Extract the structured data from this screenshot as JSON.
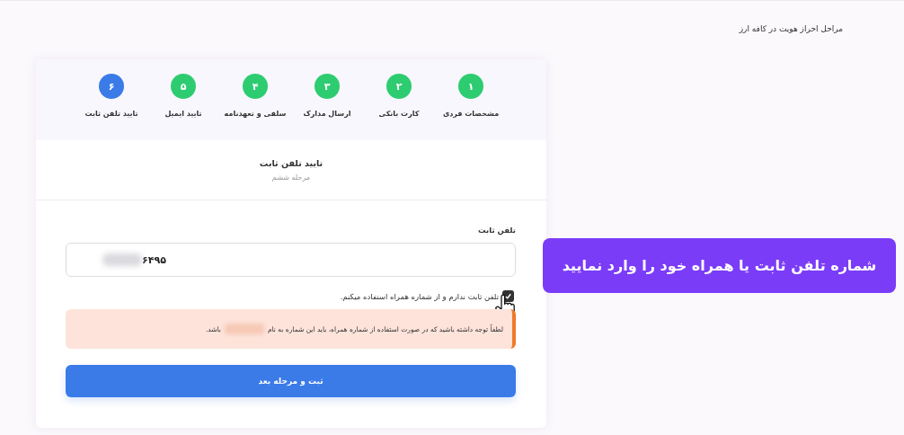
{
  "page_title": "مراحل احراز هویت در کافه ارز",
  "steps": [
    {
      "number": "۱",
      "label": "مشخصات فردی",
      "selected": false
    },
    {
      "number": "۲",
      "label": "کارت بانکی",
      "selected": false
    },
    {
      "number": "۳",
      "label": "ارسال مدارک",
      "selected": false
    },
    {
      "number": "۴",
      "label": "سلفی و تعهدنامه",
      "selected": false
    },
    {
      "number": "۵",
      "label": "تایید ایمیل",
      "selected": false
    },
    {
      "number": "۶",
      "label": "تایید تلفن ثابت",
      "selected": true
    }
  ],
  "section": {
    "title": "تایید تلفن ثابت",
    "subtitle": "مرحله ششم"
  },
  "phone_field": {
    "label": "تلفن ثابت",
    "value": "۶۴۹۵",
    "value_blurred": true
  },
  "no_landline": {
    "label": "تلفن ثابت ندارم و از شماره همراه استفاده میکنم.",
    "checked": true
  },
  "notice": {
    "before": "لطفاً توجه داشته باشید که در صورت استفاده از شماره همراه، باید این شماره به نام",
    "after": "باشد."
  },
  "submit_button": "ثبت و مرحله بعد",
  "banner": "شماره تلفن ثابت یا همراه خود را وارد نمایید"
}
